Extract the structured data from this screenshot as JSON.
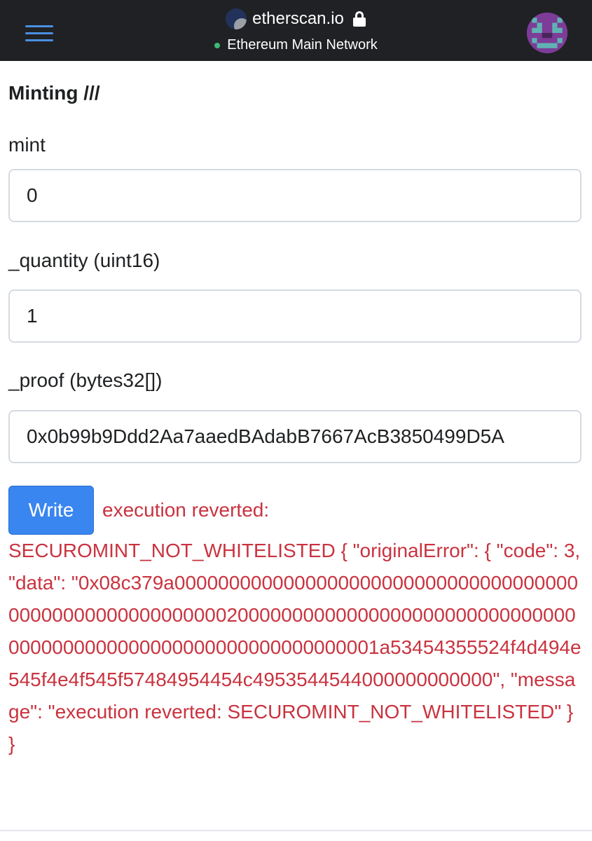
{
  "header": {
    "site_name": "etherscan.io",
    "network": "Ethereum Main Network",
    "icons": {
      "menu": "hamburger-menu-icon",
      "logo": "etherscan-logo-icon",
      "lock": "lock-icon",
      "status": "network-status-dot",
      "avatar": "pixel-avatar"
    },
    "colors": {
      "bar": "#202124",
      "menu": "#4a90e2",
      "status_dot": "#3cb878"
    }
  },
  "section": {
    "title": "Minting ///"
  },
  "fields": {
    "mint": {
      "label": "mint",
      "value": "0"
    },
    "quantity": {
      "label": "_quantity (uint16)",
      "value": "1"
    },
    "proof": {
      "label": "_proof (bytes32[])",
      "value": "0x0b99b9Ddd2Aa7aaedBAdabB7667AcB3850499D5A"
    }
  },
  "actions": {
    "write_label": "Write"
  },
  "result": {
    "color": "#c9333f",
    "headline": "execution reverted:",
    "body": "SECUROMINT_NOT_WHITELISTED { \"originalError\": { \"code\": 3, \"data\": \"0x08c379a000000000000000000000000000000000000000000000000000000000200000000000000000000000000000000000000000000000000000000000000001a53454355524f4d494e545f4e4f545f57484954454c4953544544000000000000\", \"message\": \"execution reverted: SECUROMINT_NOT_WHITELISTED\" } }"
  }
}
